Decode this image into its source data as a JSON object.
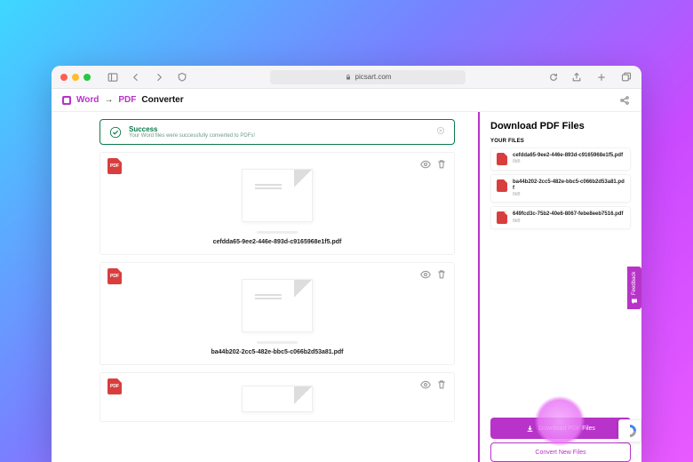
{
  "browser": {
    "url": "picsart.com"
  },
  "header": {
    "word": "Word",
    "arrow": "→",
    "pdf": "PDF",
    "converter": "Converter"
  },
  "banner": {
    "title": "Success",
    "subtitle": "Your Word files were successfully converted to PDFs!"
  },
  "cards": [
    {
      "name": "cefdda65-9ee2-446e-893d-c9165968e1f5.pdf"
    },
    {
      "name": "ba44b202-2cc5-482e-bbc5-c066b2d53a81.pdf"
    },
    {
      "name": ""
    }
  ],
  "sidebar": {
    "title": "Download PDF Files",
    "your_files_label": "YOUR FILES",
    "files": [
      {
        "name": "cefdda65-9ee2-446e-893d-c9165968e1f5.pdf",
        "size": "8kB"
      },
      {
        "name": "ba44b202-2cc5-482e-bbc5-c066b2d53a81.pdf",
        "size": "8kB"
      },
      {
        "name": "649fcd3c-75b2-40e6-8067-febe8eeb7516.pdf",
        "size": "8kB"
      }
    ],
    "download_label": "Download PDF Files",
    "convert_label": "Convert New Files"
  },
  "feedback": {
    "label": "Feedback"
  }
}
